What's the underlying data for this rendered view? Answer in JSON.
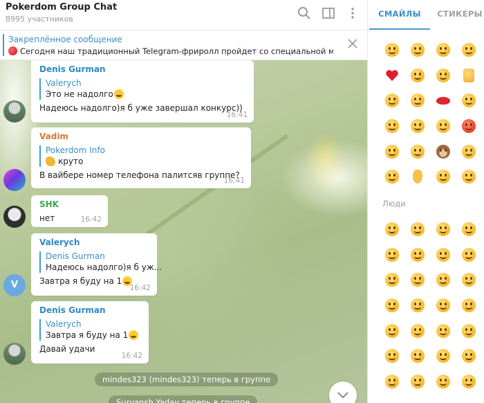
{
  "header": {
    "title": "Pokerdom Group Chat",
    "subtitle": "8995 участников",
    "icons": [
      "search-icon",
      "sidebar-toggle-icon",
      "more-vertical-icon"
    ]
  },
  "pinned": {
    "title": "Закреплённое сообщение",
    "text": "Сегодня наш традиционный Telegram-фриролл пройдет со специальной ми..."
  },
  "messages": [
    {
      "sender": "Denis Gurman",
      "sender_color": "#2d89c4",
      "reply_name": "Valerych",
      "reply_text": "Это не надолго",
      "text": "Надеюсь надолго)я б уже завершал конкурс))",
      "time": "16:41"
    },
    {
      "sender": "Vadim",
      "sender_color": "#d57a3a",
      "reply_name": "Pokerdom Info",
      "reply_text": "круто",
      "text": "В вайбере номер телефона палитсяв группе?",
      "time": "16:41"
    },
    {
      "sender": "SHK",
      "sender_color": "#3aa84a",
      "text": "нет",
      "time": "16:42"
    },
    {
      "sender": "Valerych",
      "sender_color": "#2d89c4",
      "reply_name": "Denis Gurman",
      "reply_text": "Надеюсь надолго)я б уж...",
      "text": "Завтра я буду на 1",
      "time": "16:42",
      "avatar_letter": "V"
    },
    {
      "sender": "Denis Gurman",
      "sender_color": "#2d89c4",
      "reply_name": "Valerych",
      "reply_text": "Завтра я буду на 1",
      "text": "Давай удачи",
      "time": "16:42"
    }
  ],
  "service": {
    "joined": "mindes323 (mindes323) теперь в группе",
    "joined2": "Suryansh Yadav теперь в группе"
  },
  "panel": {
    "tab_emoji": "СМАЙЛЫ",
    "tab_stickers": "СТИКЕРЫ",
    "section_people": "Люди"
  }
}
